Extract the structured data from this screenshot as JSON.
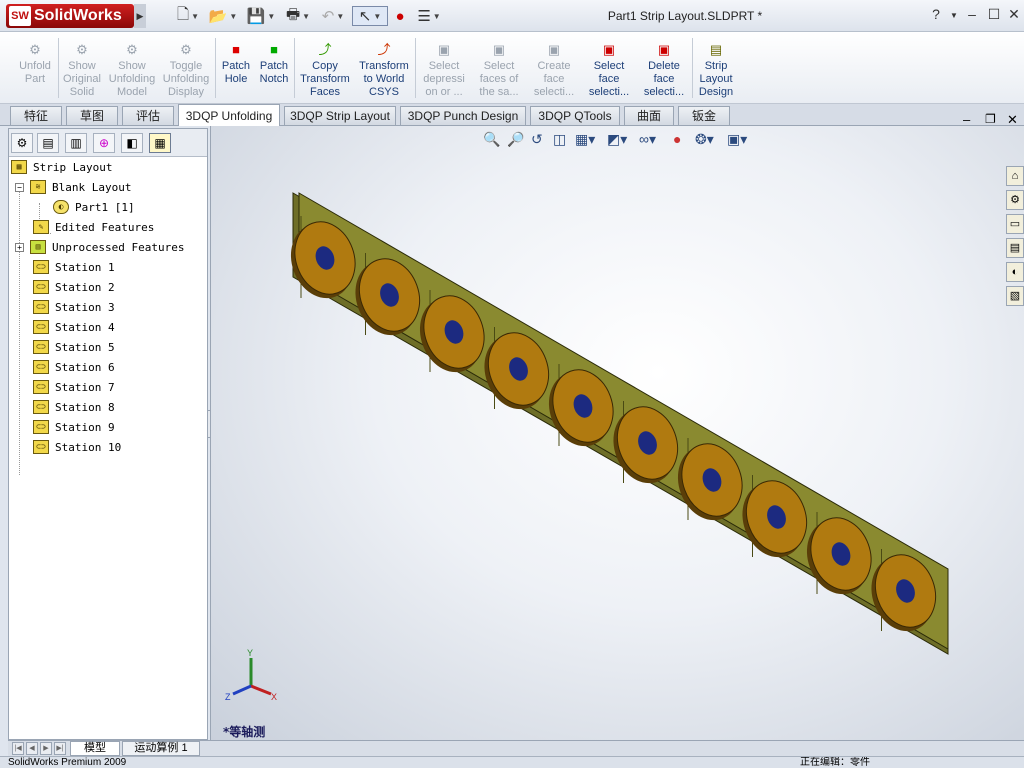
{
  "app": {
    "brand": "SolidWorks",
    "brand_mark": "SW",
    "document_title": "Part1 Strip Layout.SLDPRT *",
    "help": "?",
    "minimize": "–",
    "maximize": "☐",
    "close": "✕"
  },
  "quick_access": [
    {
      "name": "new-doc-icon",
      "glyph": "🗋"
    },
    {
      "name": "open-icon",
      "glyph": "📂"
    },
    {
      "name": "save-icon",
      "glyph": "💾"
    },
    {
      "name": "print-icon",
      "glyph": "🖶"
    },
    {
      "name": "undo-icon",
      "glyph": "↶"
    },
    {
      "name": "select-icon",
      "glyph": "↖"
    },
    {
      "name": "rebuild-icon",
      "glyph": "🚦"
    },
    {
      "name": "options-icon",
      "glyph": "☰"
    }
  ],
  "commands": [
    {
      "lines": [
        "Unfold",
        "Part"
      ],
      "enabled": false,
      "glyph": "⚙"
    },
    {
      "lines": [
        "Show",
        "Original",
        "Solid"
      ],
      "enabled": false,
      "glyph": "⚙"
    },
    {
      "lines": [
        "Show",
        "Unfolding",
        "Model"
      ],
      "enabled": false,
      "glyph": "⚙"
    },
    {
      "lines": [
        "Toggle",
        "Unfolding",
        "Display"
      ],
      "enabled": false,
      "glyph": "⚙"
    },
    {
      "lines": [
        "Patch",
        "Hole"
      ],
      "enabled": true,
      "glyph": "■"
    },
    {
      "lines": [
        "Patch",
        "Notch"
      ],
      "enabled": true,
      "glyph": "■"
    },
    {
      "lines": [
        "Copy",
        "Transform",
        "Faces"
      ],
      "enabled": true,
      "glyph": "⤴"
    },
    {
      "lines": [
        "Transform",
        "to World",
        "CSYS"
      ],
      "enabled": true,
      "glyph": "⤴"
    },
    {
      "lines": [
        "Select",
        "depressi",
        "on or ..."
      ],
      "enabled": false,
      "glyph": "▣"
    },
    {
      "lines": [
        "Select",
        "faces of",
        "the sa..."
      ],
      "enabled": false,
      "glyph": "▣"
    },
    {
      "lines": [
        "Create",
        "face",
        "selecti..."
      ],
      "enabled": false,
      "glyph": "▣"
    },
    {
      "lines": [
        "Select",
        "face",
        "selecti..."
      ],
      "enabled": true,
      "glyph": "▣"
    },
    {
      "lines": [
        "Delete",
        "face",
        "selecti..."
      ],
      "enabled": true,
      "glyph": "▣"
    },
    {
      "lines": [
        "Strip",
        "Layout",
        "Design"
      ],
      "enabled": true,
      "glyph": "▤"
    }
  ],
  "tabs": [
    "特征",
    "草图",
    "评估",
    "3DQP Unfolding",
    "3DQP Strip Layout",
    "3DQP Punch Design",
    "3DQP QTools",
    "曲面",
    "钣金"
  ],
  "active_tab": "3DQP Unfolding",
  "tree": {
    "root": "Strip Layout",
    "blank_layout": "Blank Layout",
    "part": "Part1 [1]",
    "edited_features": "Edited Features",
    "unprocessed_features": "Unprocessed Features",
    "stations": [
      "Station 1",
      "Station 2",
      "Station 3",
      "Station 4",
      "Station 5",
      "Station 6",
      "Station 7",
      "Station 8",
      "Station 9",
      "Station 10"
    ],
    "collapse_symbol": "−",
    "expand_symbol": "+"
  },
  "viewport": {
    "view_label": "*等轴测",
    "triad": {
      "x": "X",
      "y": "Y",
      "z": "Z"
    },
    "strip_color": "#8a8a30",
    "disc_color": "#b07a10",
    "hole_color": "#1c2a80",
    "disc_count": 10
  },
  "bottom_tabs": [
    "模型",
    "运动算例 1"
  ],
  "status": {
    "left": "SolidWorks Premium 2009",
    "right": "正在编辑：零件"
  },
  "colors": {
    "accent": "#1d3f78",
    "brand": "#c01010"
  }
}
